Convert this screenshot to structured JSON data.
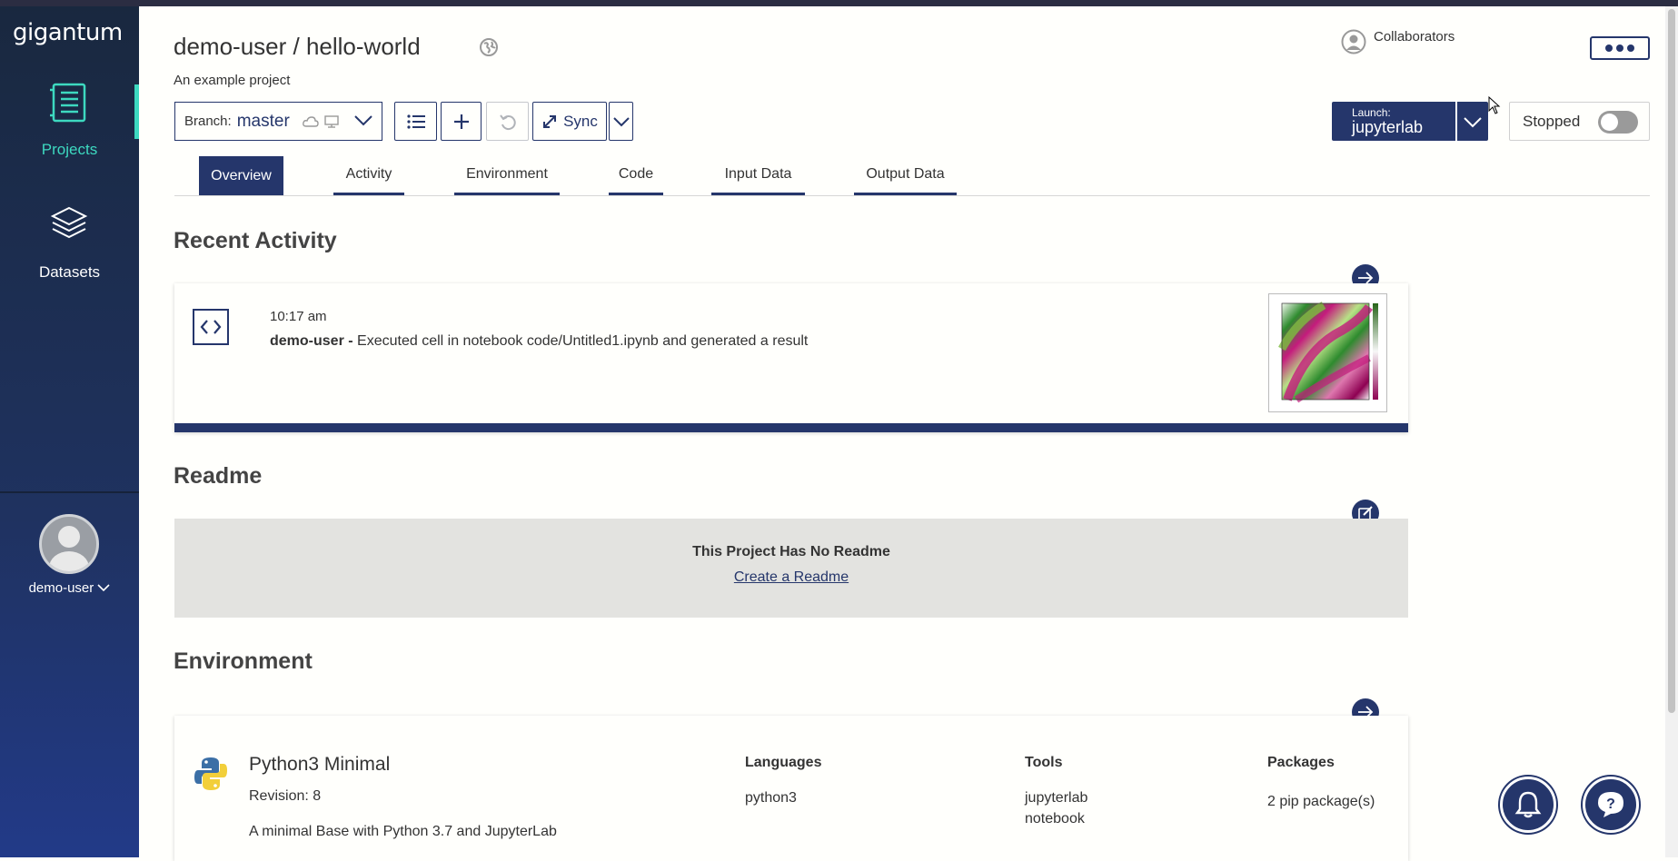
{
  "app": {
    "logo": "gigantum"
  },
  "sidebar": {
    "items": [
      {
        "label": "Projects",
        "icon": "notebook-icon",
        "active": true
      },
      {
        "label": "Datasets",
        "icon": "layers-icon",
        "active": false
      }
    ],
    "user": {
      "name": "demo-user"
    }
  },
  "header": {
    "title": "demo-user / hello-world",
    "description": "An example project",
    "collaborators_label": "Collaborators"
  },
  "toolbar": {
    "branch_label": "Branch:",
    "branch_name": "master",
    "sync_label": "Sync",
    "launch_small": "Launch:",
    "launch_app": "jupyterlab",
    "status_label": "Stopped"
  },
  "tabs": [
    {
      "label": "Overview",
      "active": true
    },
    {
      "label": "Activity"
    },
    {
      "label": "Environment"
    },
    {
      "label": "Code"
    },
    {
      "label": "Input Data"
    },
    {
      "label": "Output Data"
    }
  ],
  "recent_activity": {
    "heading": "Recent Activity",
    "time": "10:17 am",
    "user": "demo-user -",
    "message": "Executed cell in notebook code/Untitled1.ipynb and generated a result"
  },
  "readme": {
    "heading": "Readme",
    "empty_title": "This Project Has No Readme",
    "create_link": "Create a Readme"
  },
  "environment": {
    "heading": "Environment",
    "name": "Python3 Minimal",
    "revision": "Revision: 8",
    "description": "A minimal Base with Python 3.7 and JupyterLab",
    "languages_label": "Languages",
    "languages": [
      "python3"
    ],
    "tools_label": "Tools",
    "tools": [
      "jupyterlab",
      "notebook"
    ],
    "packages_label": "Packages",
    "packages": "2 pip package(s)"
  },
  "colors": {
    "primary": "#25366b",
    "accent": "#3dd9c0"
  }
}
